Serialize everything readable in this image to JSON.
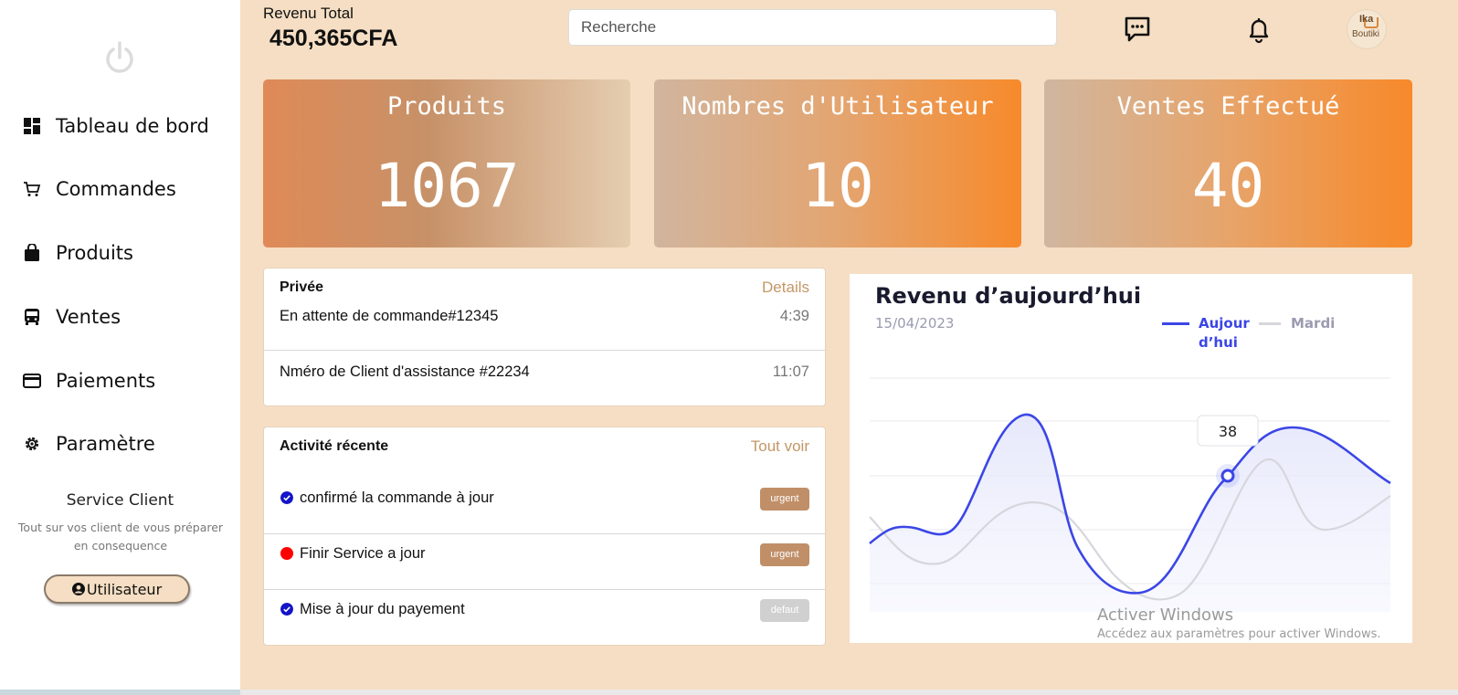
{
  "sidebar": {
    "items": [
      {
        "label": "Tableau de bord",
        "icon": "dashboard-icon"
      },
      {
        "label": "Commandes",
        "icon": "cart-icon"
      },
      {
        "label": "Produits",
        "icon": "shopping-bag-icon"
      },
      {
        "label": "Ventes",
        "icon": "bus-icon"
      },
      {
        "label": "Paiements",
        "icon": "credit-card-icon"
      },
      {
        "label": "Paramètre",
        "icon": "gear-icon"
      }
    ],
    "service_title": "Service Client",
    "service_desc": "Tout sur vos client de vous préparer en consequence",
    "user_button": "Utilisateur"
  },
  "header": {
    "revenue_label": "Revenu Total",
    "revenue_value": "450,365CFA",
    "search_placeholder": "Recherche",
    "avatar_text_top": "Ika",
    "avatar_text_bottom": "Boutiki"
  },
  "stats": [
    {
      "title": "Produits",
      "value": "1067"
    },
    {
      "title": "Nombres d'Utilisateur",
      "value": "10"
    },
    {
      "title": "Ventes Effectué",
      "value": "40"
    }
  ],
  "private_card": {
    "title": "Privée",
    "link": "Details",
    "rows": [
      {
        "text": "En attente de commande#12345",
        "time": "4:39"
      },
      {
        "text": "Nméro de Client d'assistance #22234",
        "time": "11:07"
      }
    ]
  },
  "activity_card": {
    "title": "Activité récente",
    "link": "Tout voir",
    "rows": [
      {
        "text": "confirmé la commande à jour",
        "badge": "urgent",
        "status": "check"
      },
      {
        "text": "Finir Service a jour",
        "badge": "urgent",
        "status": "red"
      },
      {
        "text": "Mise à jour du payement",
        "badge": "defaut",
        "status": "check"
      }
    ]
  },
  "chart_data": {
    "type": "line",
    "title": "Revenu d’aujourd’hui",
    "subtitle": "15/04/2023",
    "tooltip_value": "38",
    "series": [
      {
        "name": "Aujour d’hui",
        "color": "#3b46e6"
      },
      {
        "name": "Mardi",
        "color": "#d6d6dc"
      }
    ],
    "legend_position": "top-right",
    "grid": true
  },
  "watermark": {
    "line1": "Activer Windows",
    "line2": "Accédez aux paramètres pour activer Windows."
  },
  "colors": {
    "background": "#f5dec3",
    "accent": "#c49765",
    "badge_urgent": "#c08f68",
    "badge_default": "#d0d0d0",
    "line_today": "#3b46e6"
  }
}
